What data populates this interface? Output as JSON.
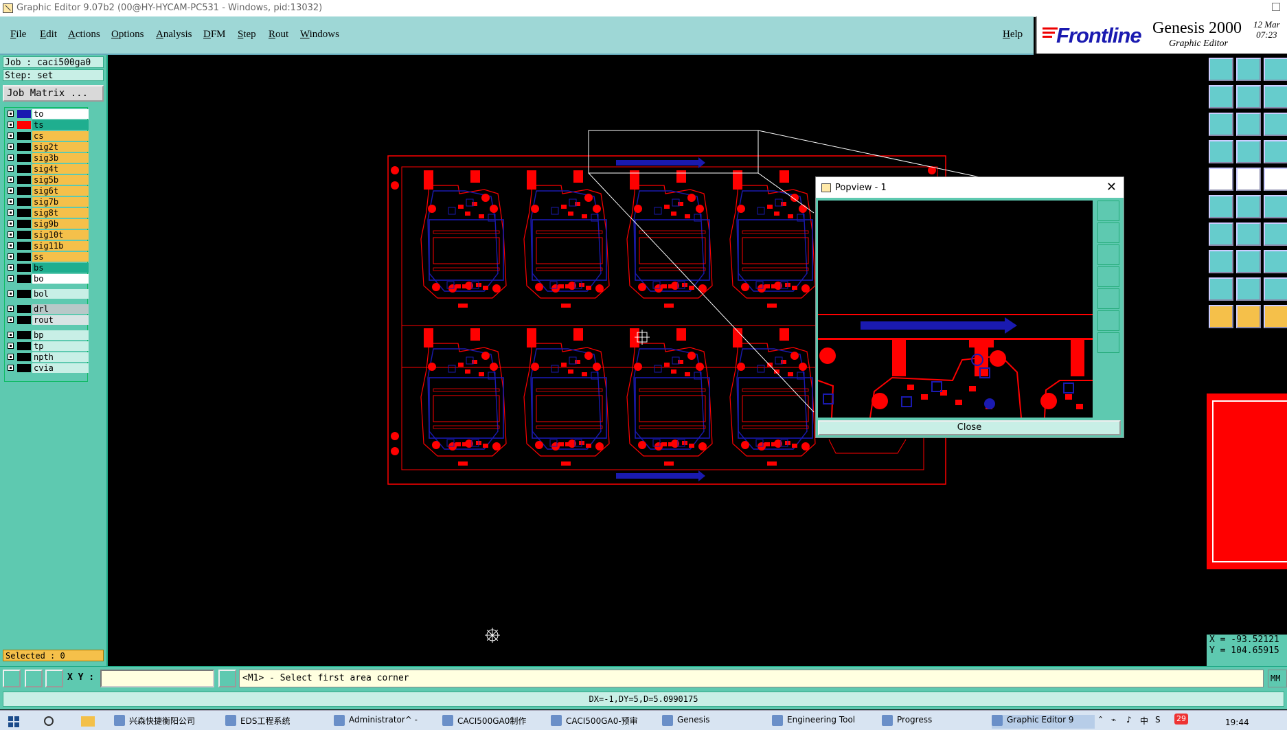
{
  "window": {
    "title": "Graphic Editor 9.07b2 (00@HY-HYCAM-PC531 - Windows, pid:13032)"
  },
  "menu": {
    "items": [
      "File",
      "Edit",
      "Actions",
      "Options",
      "Analysis",
      "DFM",
      "Step",
      "Rout",
      "Windows"
    ],
    "help": "Help"
  },
  "brand": {
    "logo": "Frontline",
    "product": "Genesis 2000",
    "subtitle": "Graphic Editor",
    "date": "12 Mar",
    "time": "07:23"
  },
  "job": {
    "job_text": "Job : caci500ga0",
    "step_text": "Step: set",
    "matrix_label": "Job Matrix ..."
  },
  "layers": [
    {
      "name": "to",
      "color": "#ffffff",
      "swatch": "#1a1ab0"
    },
    {
      "name": "ts",
      "color": "#1fae8f",
      "swatch": "#ff0000"
    },
    {
      "name": "cs",
      "color": "#f5c04a",
      "swatch": "#000000"
    },
    {
      "name": "sig2t",
      "color": "#f5c04a",
      "swatch": "#000000"
    },
    {
      "name": "sig3b",
      "color": "#f5c04a",
      "swatch": "#000000"
    },
    {
      "name": "sig4t",
      "color": "#f5c04a",
      "swatch": "#000000"
    },
    {
      "name": "sig5b",
      "color": "#f5c04a",
      "swatch": "#000000"
    },
    {
      "name": "sig6t",
      "color": "#f5c04a",
      "swatch": "#000000"
    },
    {
      "name": "sig7b",
      "color": "#f5c04a",
      "swatch": "#000000"
    },
    {
      "name": "sig8t",
      "color": "#f5c04a",
      "swatch": "#000000"
    },
    {
      "name": "sig9b",
      "color": "#f5c04a",
      "swatch": "#000000"
    },
    {
      "name": "sig10t",
      "color": "#f5c04a",
      "swatch": "#000000"
    },
    {
      "name": "sig11b",
      "color": "#f5c04a",
      "swatch": "#000000"
    },
    {
      "name": "ss",
      "color": "#f5c04a",
      "swatch": "#000000"
    },
    {
      "name": "bs",
      "color": "#1fae8f",
      "swatch": "#000000"
    },
    {
      "name": "bo",
      "color": "#ffffff",
      "swatch": "#000000"
    },
    {
      "name": "bol",
      "color": "#c8efe6",
      "swatch": "#000000"
    },
    {
      "name": "drl",
      "color": "#b8c8c8",
      "swatch": "#000000"
    },
    {
      "name": "rout",
      "color": "#d8e4e4",
      "swatch": "#000000"
    },
    {
      "name": "bp",
      "color": "#c8efe6",
      "swatch": "#000000"
    },
    {
      "name": "tp",
      "color": "#c8efe6",
      "swatch": "#000000"
    },
    {
      "name": "npth",
      "color": "#c8efe6",
      "swatch": "#000000"
    },
    {
      "name": "cvia",
      "color": "#c8efe6",
      "swatch": "#000000"
    }
  ],
  "selected_text": "Selected : 0",
  "popview": {
    "title": "Popview - 1",
    "close_label": "Close"
  },
  "readout": {
    "x": "X = -93.52121",
    "y": "Y = 104.65915"
  },
  "command": {
    "xy_label": "X Y :",
    "xy_value": "",
    "prompt": "<M1> - Select first area corner",
    "units": "MM"
  },
  "status": {
    "text": "DX=-1,DY=5,D=5.0990175"
  },
  "taskbar": {
    "items": [
      "兴森快捷衡阳公司",
      "EDS工程系统",
      "Administrator^ -",
      "CACI500GA0制作",
      "CACI500GA0-预审",
      "Genesis",
      "Engineering Tool",
      "Progress",
      "Graphic Editor 9"
    ],
    "clock": "19:44",
    "tray_badge": "29",
    "ime": "中"
  },
  "colors": {
    "accent": "#5ec9b0",
    "menubar": "#9ed7d6",
    "copper": "#ff0000",
    "silk": "#1a1ab0"
  }
}
